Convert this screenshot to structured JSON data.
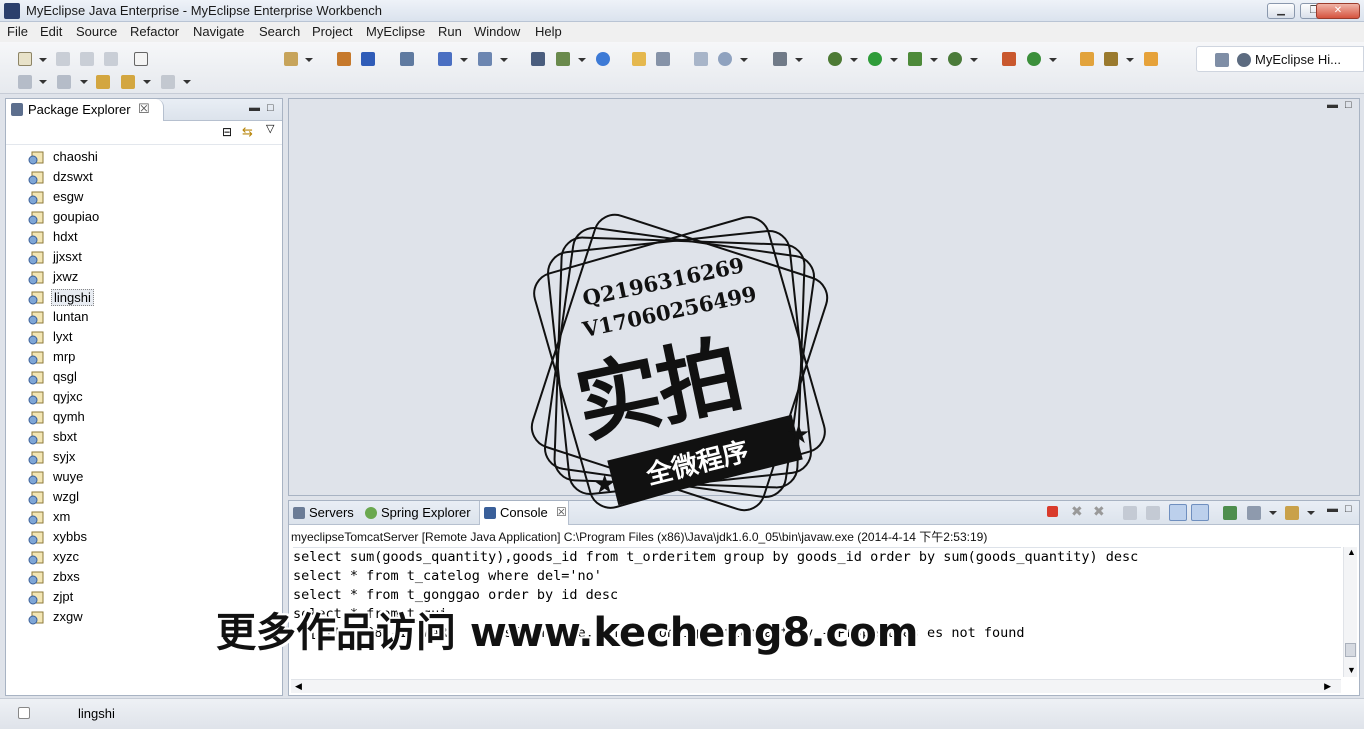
{
  "window": {
    "title": "MyEclipse Java Enterprise - MyEclipse Enterprise Workbench"
  },
  "menu": [
    "File",
    "Edit",
    "Source",
    "Refactor",
    "Navigate",
    "Search",
    "Project",
    "MyEclipse",
    "Run",
    "Window",
    "Help"
  ],
  "perspective": {
    "label": "MyEclipse Hi..."
  },
  "package_explorer": {
    "title": "Package Explorer",
    "projects": [
      "chaoshi",
      "dzswxt",
      "esgw",
      "goupiao",
      "hdxt",
      "jjxsxt",
      "jxwz",
      "lingshi",
      "luntan",
      "lyxt",
      "mrp",
      "qsgl",
      "qyjxc",
      "qymh",
      "sbxt",
      "syjx",
      "wuye",
      "wzgl",
      "xm",
      "xybbs",
      "xyzc",
      "zbxs",
      "zjpt",
      "zxgw"
    ],
    "selected": "lingshi"
  },
  "console": {
    "tabs": [
      "Servers",
      "Spring Explorer",
      "Console"
    ],
    "active_tab": "Console",
    "description": "myeclipseTomcatServer [Remote Java Application] C:\\Program Files (x86)\\Java\\jdk1.6.0_05\\bin\\javaw.exe (2014-4-14 下午2:53:19)",
    "lines": [
      "select sum(goods_quantity),goods_id from t_orderitem group by goods_id order by sum(goods_quantity) desc",
      "select * from t_catelog where del='no'",
      "select * from t_gonggao order by id desc",
      "select * from t_gui",
      "  [http-8080-1] WARN  net.sf.ehcache.config.ConfigurationFactory - Properties es not found"
    ]
  },
  "statusbar": {
    "selection": "lingshi"
  },
  "watermark": {
    "qq": "Q2196316269",
    "vx": "V17060256499",
    "big": "实拍",
    "ribbon": "全微程序",
    "site": "更多作品访问 www.kecheng8.com"
  }
}
